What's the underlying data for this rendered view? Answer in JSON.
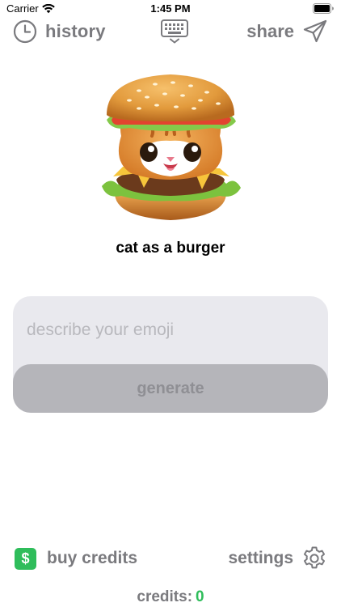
{
  "status_bar": {
    "carrier": "Carrier",
    "time": "1:45 PM"
  },
  "topbar": {
    "history_label": "history",
    "share_label": "share"
  },
  "emoji": {
    "caption": "cat as a burger",
    "icon": "cat-burger-emoji"
  },
  "composer": {
    "value": "",
    "placeholder": "describe your emoji",
    "generate_label": "generate"
  },
  "bottom": {
    "buy_label": "buy credits",
    "buy_icon_glyph": "$",
    "settings_label": "settings",
    "credits_label": "credits:",
    "credits_value": "0"
  },
  "colors": {
    "accent_green": "#2fbd5b",
    "muted_text": "#7a7a7e",
    "input_bg": "#e9e9ee",
    "button_disabled": "#b5b5ba"
  }
}
